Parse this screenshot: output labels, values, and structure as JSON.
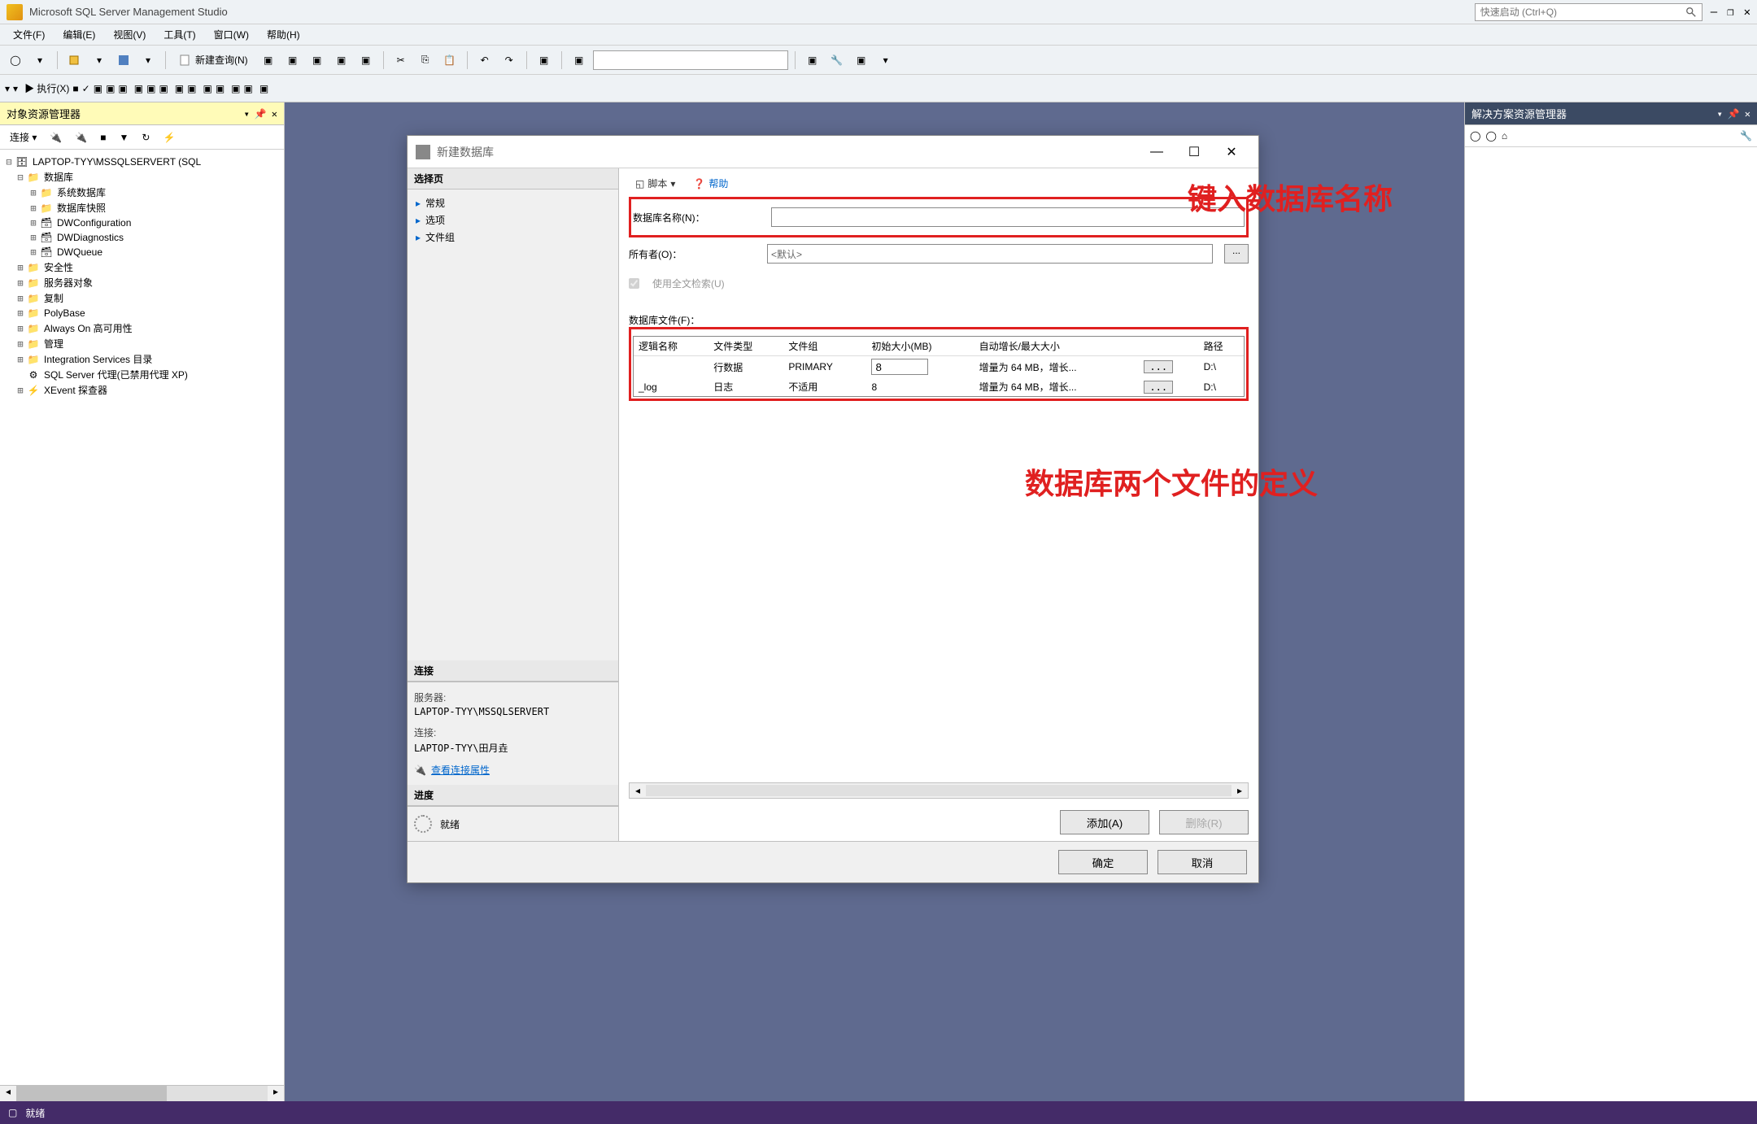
{
  "app": {
    "title": "Microsoft SQL Server Management Studio",
    "quick_launch_placeholder": "快速启动 (Ctrl+Q)"
  },
  "menu": {
    "file": "文件(F)",
    "edit": "编辑(E)",
    "view": "视图(V)",
    "tools": "工具(T)",
    "window": "窗口(W)",
    "help": "帮助(H)"
  },
  "toolbar": {
    "new_query": "新建查询(N)",
    "execute": "执行(X)"
  },
  "object_explorer": {
    "title": "对象资源管理器",
    "connect": "连接",
    "root": "LAPTOP-TYY\\MSSQLSERVERT (SQL",
    "nodes": {
      "databases": "数据库",
      "sys_db": "系统数据库",
      "db_snapshot": "数据库快照",
      "dwconfig": "DWConfiguration",
      "dwdiag": "DWDiagnostics",
      "dwqueue": "DWQueue",
      "security": "安全性",
      "server_objects": "服务器对象",
      "replication": "复制",
      "polybase": "PolyBase",
      "alwayson": "Always On 高可用性",
      "management": "管理",
      "integration": "Integration Services 目录",
      "agent": "SQL Server 代理(已禁用代理 XP)",
      "xevent": "XEvent 探查器"
    }
  },
  "solution_explorer": {
    "title": "解决方案资源管理器"
  },
  "dialog": {
    "title": "新建数据库",
    "select_page": "选择页",
    "pages": {
      "general": "常规",
      "options": "选项",
      "filegroups": "文件组"
    },
    "script": "脚本",
    "help": "帮助",
    "db_name_label": "数据库名称(N)：",
    "db_name_value": "",
    "owner_label": "所有者(O)：",
    "owner_value": "<默认>",
    "fulltext_label": "使用全文检索(U)",
    "db_files_label": "数据库文件(F)：",
    "columns": {
      "logical_name": "逻辑名称",
      "file_type": "文件类型",
      "filegroup": "文件组",
      "initial_size": "初始大小(MB)",
      "autogrow": "自动增长/最大大小",
      "path": "路径"
    },
    "rows": [
      {
        "logical_name": "",
        "file_type": "行数据",
        "filegroup": "PRIMARY",
        "initial_size": "8",
        "autogrow": "增量为 64 MB，增长...",
        "path": "D:\\"
      },
      {
        "logical_name": "_log",
        "file_type": "日志",
        "filegroup": "不适用",
        "initial_size": "8",
        "autogrow": "增量为 64 MB，增长...",
        "path": "D:\\"
      }
    ],
    "connection_section": "连接",
    "server_label": "服务器:",
    "server_value": "LAPTOP-TYY\\MSSQLSERVERT",
    "conn_label": "连接:",
    "conn_value": "LAPTOP-TYY\\田月垚",
    "view_conn_props": "查看连接属性",
    "progress_section": "进度",
    "progress_ready": "就绪",
    "add_btn": "添加(A)",
    "remove_btn": "删除(R)",
    "ok": "确定",
    "cancel": "取消"
  },
  "annotations": {
    "a1": "键入数据库名称",
    "a2": "数据库两个文件的定义"
  },
  "statusbar": {
    "ready": "就绪"
  }
}
